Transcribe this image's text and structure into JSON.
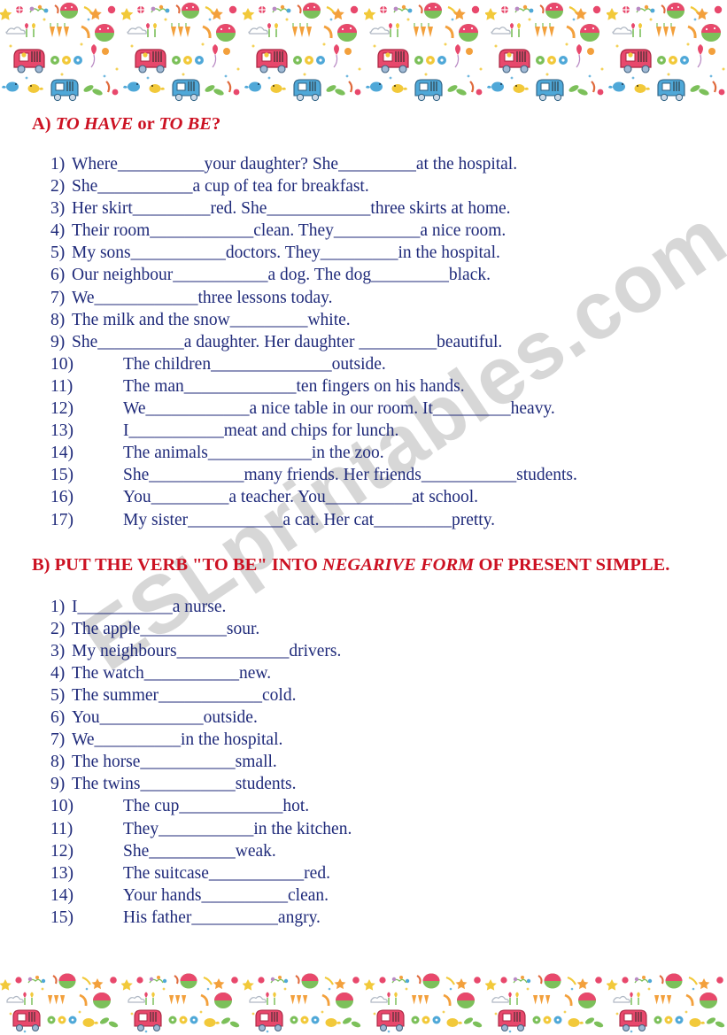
{
  "document": {
    "watermark": "ESLprintables.com",
    "text_color": "#1f2a7a",
    "heading_color": "#cc1122",
    "background_color": "#ffffff"
  },
  "border": {
    "name": "doodle-pattern-border",
    "description": "repeating colourful childlike doodles: cars, balloons, flowers, birds, stars, hot-air balloons, clouds, musical notes, carrots",
    "colors": [
      "#e8486c",
      "#f3a03c",
      "#f2d43a",
      "#7cc05a",
      "#4fa8d8",
      "#b98ac4",
      "#e06a3c"
    ]
  },
  "sections": [
    {
      "id": "section-a",
      "heading_parts": [
        {
          "text": "A) ",
          "italic": false
        },
        {
          "text": "TO HAVE",
          "italic": true
        },
        {
          "text": " or ",
          "italic": false
        },
        {
          "text": "TO BE",
          "italic": true
        },
        {
          "text": "?",
          "italic": false
        }
      ],
      "heading_plain": "A) TO HAVE or TO BE?",
      "items": [
        {
          "num": "1)",
          "wide": false,
          "text": "Where__________your daughter? She_________at the hospital."
        },
        {
          "num": "2)",
          "wide": false,
          "text": "She___________a cup of tea for breakfast."
        },
        {
          "num": "3)",
          "wide": false,
          "text": "Her skirt_________red. She____________three skirts at home."
        },
        {
          "num": "4)",
          "wide": false,
          "text": "Their room____________clean. They__________a nice room."
        },
        {
          "num": "5)",
          "wide": false,
          "text": "My sons___________doctors. They_________in the hospital."
        },
        {
          "num": "6)",
          "wide": false,
          "text": "Our neighbour___________a  dog. The dog_________black."
        },
        {
          "num": "7)",
          "wide": false,
          "text": "We____________three lessons today."
        },
        {
          "num": "8)",
          "wide": false,
          "text": "The milk and the snow_________white."
        },
        {
          "num": "9)",
          "wide": false,
          "text": "She__________a daughter. Her daughter _________beautiful."
        },
        {
          "num": "10)",
          "wide": true,
          "text": "The children______________outside."
        },
        {
          "num": "11)",
          "wide": true,
          "text": "The man_____________ten fingers on his hands."
        },
        {
          "num": "12)",
          "wide": true,
          "text": "We____________a nice table in our room. It_________heavy."
        },
        {
          "num": "13)",
          "wide": true,
          "text": "I___________meat and chips for lunch."
        },
        {
          "num": "14)",
          "wide": true,
          "text": "The animals____________in the zoo."
        },
        {
          "num": "15)",
          "wide": true,
          "text": "She___________many friends. Her friends___________students."
        },
        {
          "num": "16)",
          "wide": true,
          "text": "You_________a teacher. You__________at school."
        },
        {
          "num": "17)",
          "wide": true,
          "text": "My sister___________a cat. Her cat_________pretty."
        }
      ]
    },
    {
      "id": "section-b",
      "heading_parts": [
        {
          "text": "B) PUT THE VERB \"TO BE\" INTO ",
          "italic": false
        },
        {
          "text": "NEGARIVE FORM",
          "italic": true
        },
        {
          "text": " OF PRESENT SIMPLE.",
          "italic": false
        }
      ],
      "heading_plain": "B) PUT THE VERB \"TO BE\" INTO NEGARIVE FORM OF PRESENT SIMPLE.",
      "items": [
        {
          "num": "1)",
          "wide": false,
          "text": "I___________a nurse."
        },
        {
          "num": "2)",
          "wide": false,
          "text": "The apple__________sour."
        },
        {
          "num": "3)",
          "wide": false,
          "text": "My neighbours_____________drivers."
        },
        {
          "num": "4)",
          "wide": false,
          "text": "The watch___________new."
        },
        {
          "num": "5)",
          "wide": false,
          "text": "The summer____________cold."
        },
        {
          "num": "6)",
          "wide": false,
          "text": "You____________outside."
        },
        {
          "num": "7)",
          "wide": false,
          "text": "We__________in the hospital."
        },
        {
          "num": "8)",
          "wide": false,
          "text": "The horse___________small."
        },
        {
          "num": "9)",
          "wide": false,
          "text": "The twins___________students."
        },
        {
          "num": "10)",
          "wide": true,
          "text": "The cup____________hot."
        },
        {
          "num": "11)",
          "wide": true,
          "text": "They___________in the kitchen."
        },
        {
          "num": "12)",
          "wide": true,
          "text": "She__________weak."
        },
        {
          "num": "13)",
          "wide": true,
          "text": "The suitcase___________red."
        },
        {
          "num": "14)",
          "wide": true,
          "text": "Your hands__________clean."
        },
        {
          "num": "15)",
          "wide": true,
          "text": "His father__________angry."
        }
      ]
    }
  ]
}
